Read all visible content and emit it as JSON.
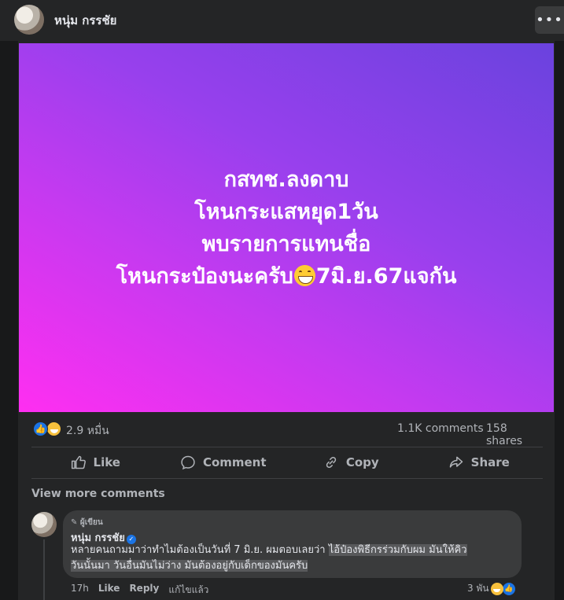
{
  "header": {
    "author": "หนุ่ม กรรชัย",
    "more_label": "•••"
  },
  "post_image": {
    "lines": [
      "กสทช.ลงดาบ",
      "โหนกระแสหยุด1วัน",
      "พบรายการแทนชื่อ"
    ],
    "last_line_before": "โหนกระป๋องนะครับ",
    "last_line_after": "7มิ.ย.67แจกัน",
    "emoji": "grinning-face"
  },
  "stats": {
    "reactions": "2.9 หมื่น",
    "comments": "1.1K comments",
    "shares": "158 shares"
  },
  "actions": {
    "like": "Like",
    "comment": "Comment",
    "copy": "Copy",
    "share": "Share"
  },
  "view_more": "View more comments",
  "comment": {
    "badge": "ผู้เขียน",
    "author": "หนุ่ม กรรชัย",
    "text_plain": "หลายคนถามมาว่าทำไมต้องเป็นวันที่ 7 มิ.ย. ผมตอบเลยว่า ",
    "text_highlight_1": "ไอ้ป๋องพิธีกรร่วมกับผม มันให้คิว",
    "text_highlight_2": "วันนั้นมา วันอื่นมันไม่ว่าง มันต้องอยู่กับเด็กของมันครับ",
    "time": "17h",
    "like": "Like",
    "reply": "Reply",
    "edited": "แก้ไขแล้ว",
    "reaction_count": "3 พัน"
  }
}
